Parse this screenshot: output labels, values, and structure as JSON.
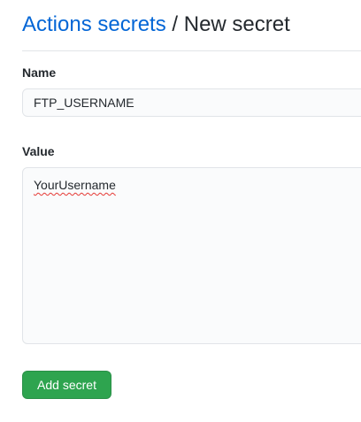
{
  "breadcrumb": {
    "parent_label": "Actions secrets",
    "separator": "/",
    "current_label": "New secret"
  },
  "form": {
    "name_label": "Name",
    "name_value": "FTP_USERNAME",
    "value_label": "Value",
    "value_text": "YourUsername",
    "submit_label": "Add secret"
  },
  "colors": {
    "link": "#0366d6",
    "button_bg": "#2ea44f",
    "spellcheck_underline": "#e53935"
  }
}
